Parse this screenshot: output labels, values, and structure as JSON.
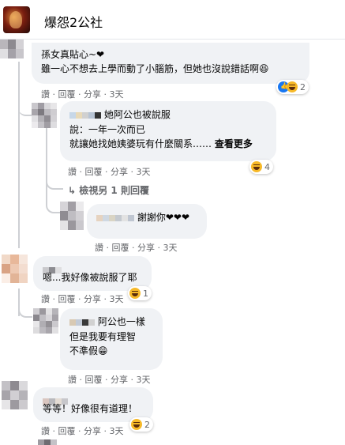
{
  "header": {
    "title": "爆怨2公社"
  },
  "actions": {
    "like": "讚",
    "reply": "回覆",
    "share": "分享",
    "sep": "·"
  },
  "comments": [
    {
      "name": "",
      "lines": [
        "孫女真貼心~❤",
        "雖一心不想去上學而動了小腦筋，但她也沒說錯話啊😆"
      ],
      "time": "3天",
      "reactions": {
        "types": [
          "like",
          "haha"
        ],
        "count": "2"
      }
    },
    {
      "name": "她阿公也被說服",
      "lines": [
        "說：一年一次而已",
        "就讓她找她姨婆玩有什麼關系……"
      ],
      "see_more": "查看更多",
      "time": "3天",
      "reactions": {
        "types": [
          "haha"
        ],
        "count": "4"
      }
    },
    {
      "view_replies": "檢視另 1 則回覆"
    },
    {
      "name": "",
      "lines": [
        "謝謝你❤❤❤"
      ],
      "time": "3天"
    },
    {
      "name": "",
      "lines": [
        "嗯...我好像被說服了耶"
      ],
      "time": "3天",
      "reactions": {
        "types": [
          "haha"
        ],
        "count": "1"
      }
    },
    {
      "name": "阿公也一樣",
      "lines": [
        "但是我要有理智",
        "不準假😁"
      ],
      "time": "3天"
    },
    {
      "name": "",
      "lines": [
        "等等！好像很有道理！"
      ],
      "time": "3天",
      "reactions": {
        "types": [
          "haha"
        ],
        "count": "2"
      }
    }
  ],
  "icons": {
    "reply_arrow": "reply-arrow-icon",
    "like": "like-reaction-icon",
    "haha": "haha-reaction-icon"
  }
}
